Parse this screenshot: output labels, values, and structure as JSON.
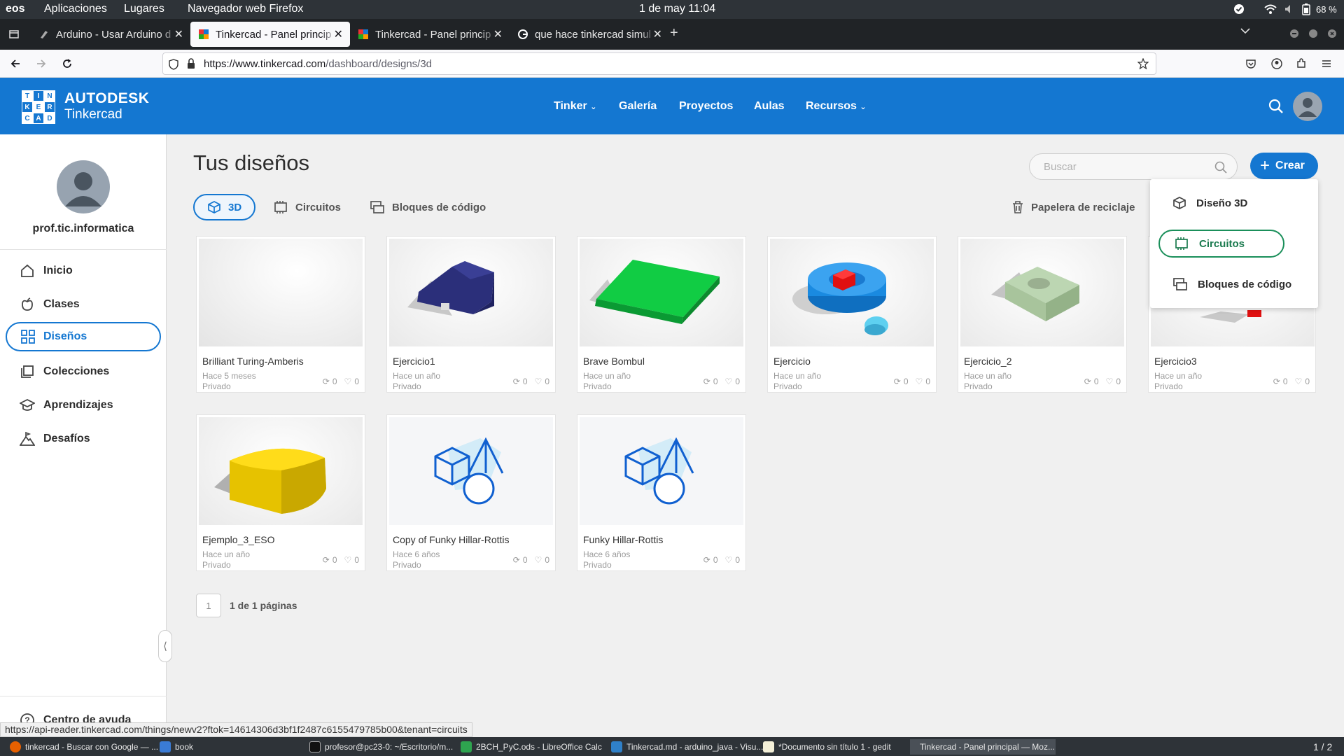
{
  "os": {
    "brand": "eos",
    "menu_apps": "Aplicaciones",
    "menu_places": "Lugares",
    "active_app": "Navegador web Firefox",
    "clock": "1 de may  11:04",
    "battery": "68 %"
  },
  "browser": {
    "tabs": [
      {
        "title": "Arduino - Usar Arduino d"
      },
      {
        "title": "Tinkercad - Panel princip"
      },
      {
        "title": "Tinkercad - Panel princip"
      },
      {
        "title": "que hace tinkercad simul"
      }
    ],
    "url_host": "https://www.tinkercad.com",
    "url_path": "/dashboard/designs/3d"
  },
  "tk": {
    "logo_letters": [
      "TIN",
      "KER",
      "CAD"
    ],
    "brand1": "AUTODESK",
    "brand2": "Tinkercad",
    "nav": {
      "tinker": "Tinker",
      "galeria": "Galería",
      "proyectos": "Proyectos",
      "aulas": "Aulas",
      "recursos": "Recursos"
    }
  },
  "sidebar": {
    "username": "prof.tic.informatica",
    "items": [
      {
        "label": "Inicio"
      },
      {
        "label": "Clases"
      },
      {
        "label": "Diseños"
      },
      {
        "label": "Colecciones"
      },
      {
        "label": "Aprendizajes"
      },
      {
        "label": "Desafíos"
      }
    ],
    "help": "Centro de ayuda"
  },
  "main": {
    "title": "Tus diseños",
    "search_placeholder": "Buscar",
    "create": "Crear",
    "filter_tabs": {
      "t3d": "3D",
      "circuitos": "Circuitos",
      "bloques": "Bloques de código"
    },
    "recycle": "Papelera de reciclaje",
    "pagination": {
      "page": "1",
      "label": "1 de 1 páginas"
    }
  },
  "designs": [
    {
      "name": "Brilliant Turing-Amberis",
      "age": "Hace 5 meses",
      "visibility": "Privado",
      "remixes": "0",
      "likes": "0"
    },
    {
      "name": "Ejercicio1",
      "age": "Hace un año",
      "visibility": "Privado",
      "remixes": "0",
      "likes": "0"
    },
    {
      "name": "Brave Bombul",
      "age": "Hace un año",
      "visibility": "Privado",
      "remixes": "0",
      "likes": "0"
    },
    {
      "name": "Ejercicio",
      "age": "Hace un año",
      "visibility": "Privado",
      "remixes": "0",
      "likes": "0"
    },
    {
      "name": "Ejercicio_2",
      "age": "Hace un año",
      "visibility": "Privado",
      "remixes": "0",
      "likes": "0"
    },
    {
      "name": "Ejercicio3",
      "age": "Hace un año",
      "visibility": "Privado",
      "remixes": "0",
      "likes": "0"
    },
    {
      "name": "Ejemplo_3_ESO",
      "age": "Hace un año",
      "visibility": "Privado",
      "remixes": "0",
      "likes": "0"
    },
    {
      "name": "Copy of Funky Hillar-Rottis",
      "age": "Hace 6 años",
      "visibility": "Privado",
      "remixes": "0",
      "likes": "0"
    },
    {
      "name": "Funky Hillar-Rottis",
      "age": "Hace 6 años",
      "visibility": "Privado",
      "remixes": "0",
      "likes": "0"
    }
  ],
  "create_menu": {
    "d3": "Diseño 3D",
    "circuitos": "Circuitos",
    "bloques": "Bloques de código"
  },
  "status_url": "https://api-reader.tinkercad.com/things/newv2?ftok=14614306d3bf1f2487c6155479785b00&tenant=circuits",
  "taskbar": {
    "items": [
      {
        "label": "tinkercad - Buscar con Google — ..."
      },
      {
        "label": "book"
      },
      {
        "label": "profesor@pc23-0: ~/Escritorio/m..."
      },
      {
        "label": "2BCH_PyC.ods - LibreOffice Calc"
      },
      {
        "label": "Tinkercad.md - arduino_java - Visu..."
      },
      {
        "label": "*Documento sin título 1 - gedit"
      },
      {
        "label": "Tinkercad - Panel principal — Moz..."
      }
    ],
    "workspace": "1 / 2"
  },
  "colors": {
    "brand_blue": "#1477d1",
    "green_highlight": "#1a8f5a"
  }
}
